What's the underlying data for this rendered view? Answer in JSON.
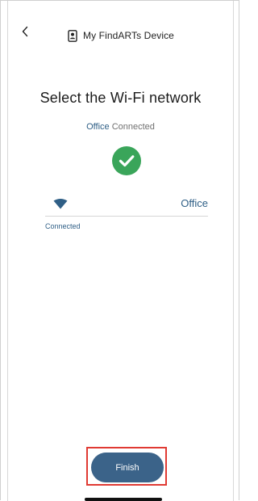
{
  "header": {
    "back_icon": "chevron-left-icon",
    "device_icon": "device-icon",
    "title": "My FindARTs Device"
  },
  "main": {
    "title": "Select the Wi-Fi network",
    "status": {
      "network": "Office",
      "text": "Connected"
    },
    "success_icon": "check-circle-icon",
    "network": {
      "icon": "wifi-icon",
      "name": "Office",
      "state": "Connected"
    }
  },
  "footer": {
    "finish_label": "Finish"
  },
  "colors": {
    "accent": "#3b6389",
    "link": "#2f5f86",
    "success": "#3aa55a",
    "highlight": "#e03a33"
  }
}
